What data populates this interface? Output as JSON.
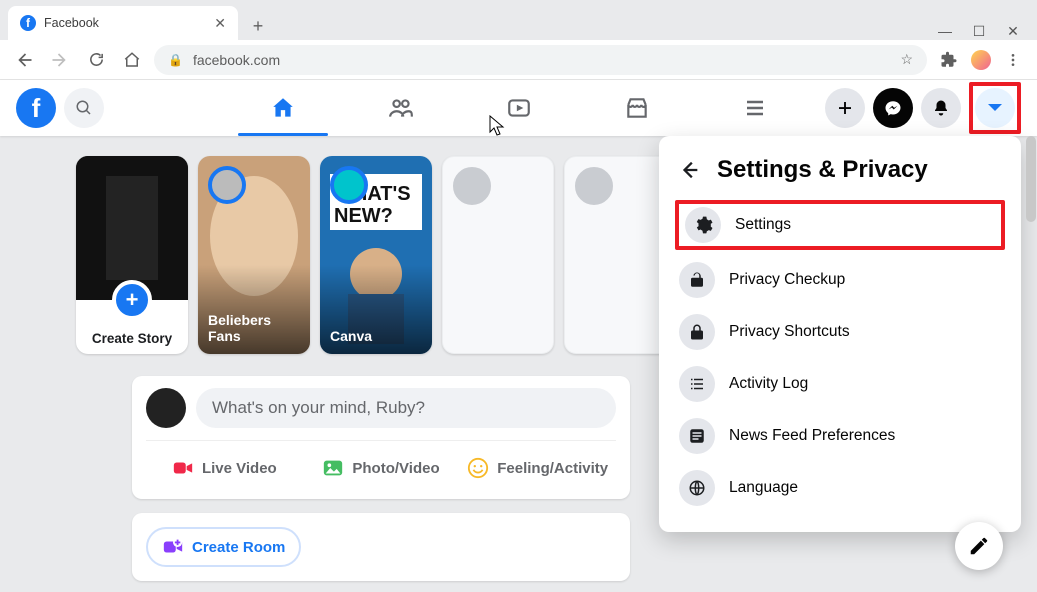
{
  "browser": {
    "tab_title": "Facebook",
    "url": "facebook.com"
  },
  "composer": {
    "prompt": "What's on your mind, Ruby?",
    "live": "Live Video",
    "photo": "Photo/Video",
    "feeling": "Feeling/Activity",
    "create_room": "Create Room"
  },
  "stories": {
    "create": "Create Story",
    "items": [
      "Beliebers Fans",
      "Canva"
    ]
  },
  "dropdown": {
    "title": "Settings & Privacy",
    "items": [
      "Settings",
      "Privacy Checkup",
      "Privacy Shortcuts",
      "Activity Log",
      "News Feed Preferences",
      "Language"
    ]
  }
}
